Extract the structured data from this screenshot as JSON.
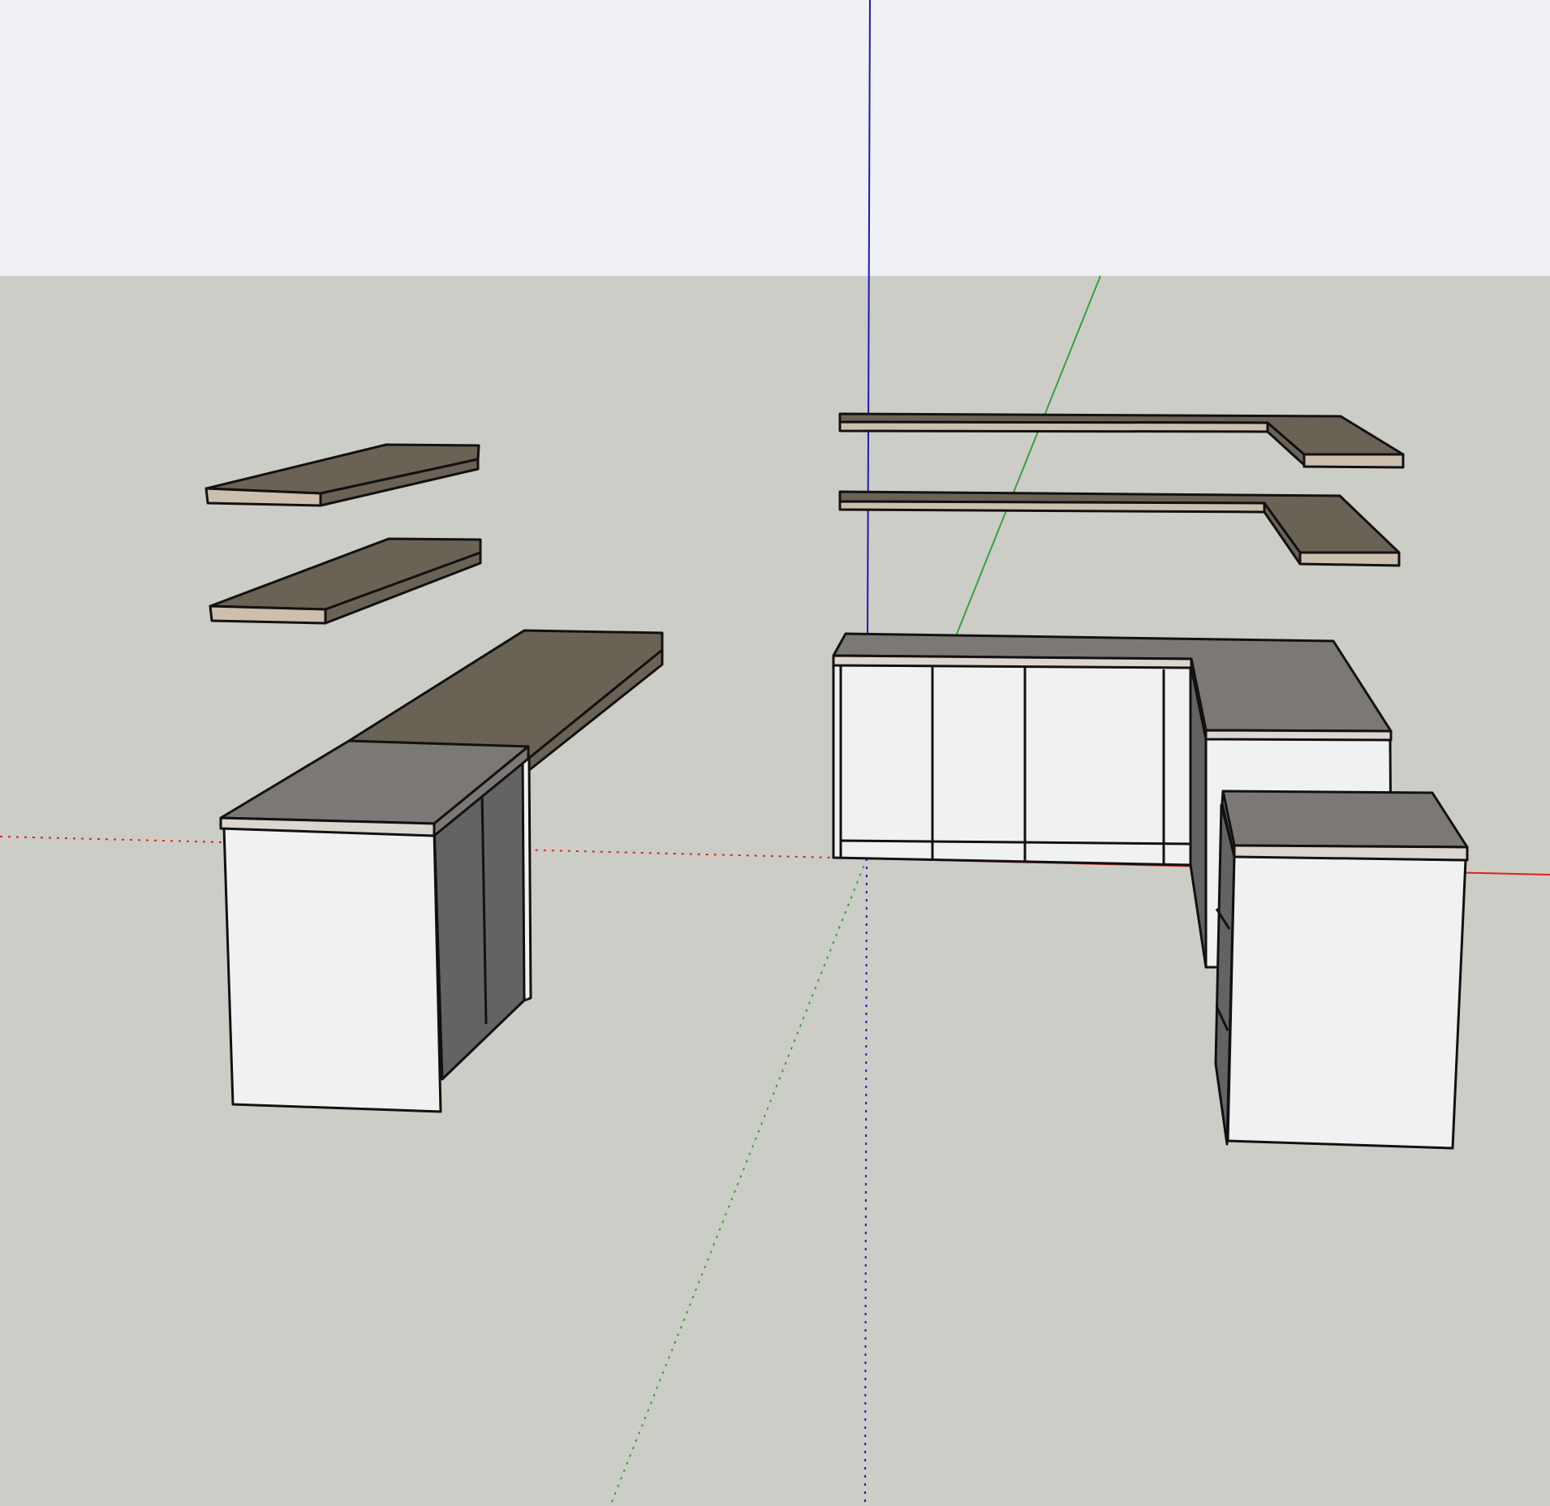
{
  "viewport": {
    "sky_color": "#eef0f3",
    "ground_color": "#cdcdc7",
    "edge_color": "#111111"
  },
  "axes": {
    "red_color": "#e0201a",
    "green_color": "#3aa03a",
    "blue_color": "#1a1ab4"
  },
  "materials": {
    "wood_top": "#6b6256",
    "wood_edge": "#cdbfae",
    "stone_top": "#7c7876",
    "stone_edge": "#dcd6cf",
    "cabinet_white": "#f0f2f1",
    "cabinet_dark": "#636363"
  },
  "model": {
    "shelves": [
      "left-upper-shelf",
      "left-lower-shelf",
      "right-upper-l-shelf",
      "right-lower-l-shelf"
    ],
    "units": [
      "left-base-cabinet",
      "left-wood-counter",
      "right-l-cabinet",
      "right-island-cabinet"
    ]
  }
}
